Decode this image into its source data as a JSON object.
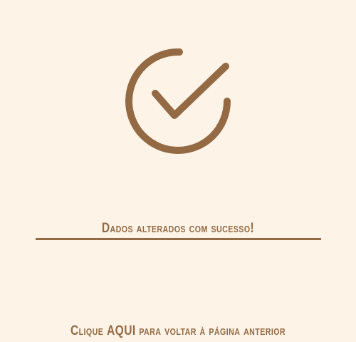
{
  "success": {
    "icon": "check-circle-icon",
    "message": "Dados alterados com sucesso!"
  },
  "back_link": {
    "prefix": "Clique",
    "emphasis": "AQUI",
    "suffix": "para voltar à página anterior"
  },
  "colors": {
    "background": "#fdf4e7",
    "accent": "#946a44"
  }
}
